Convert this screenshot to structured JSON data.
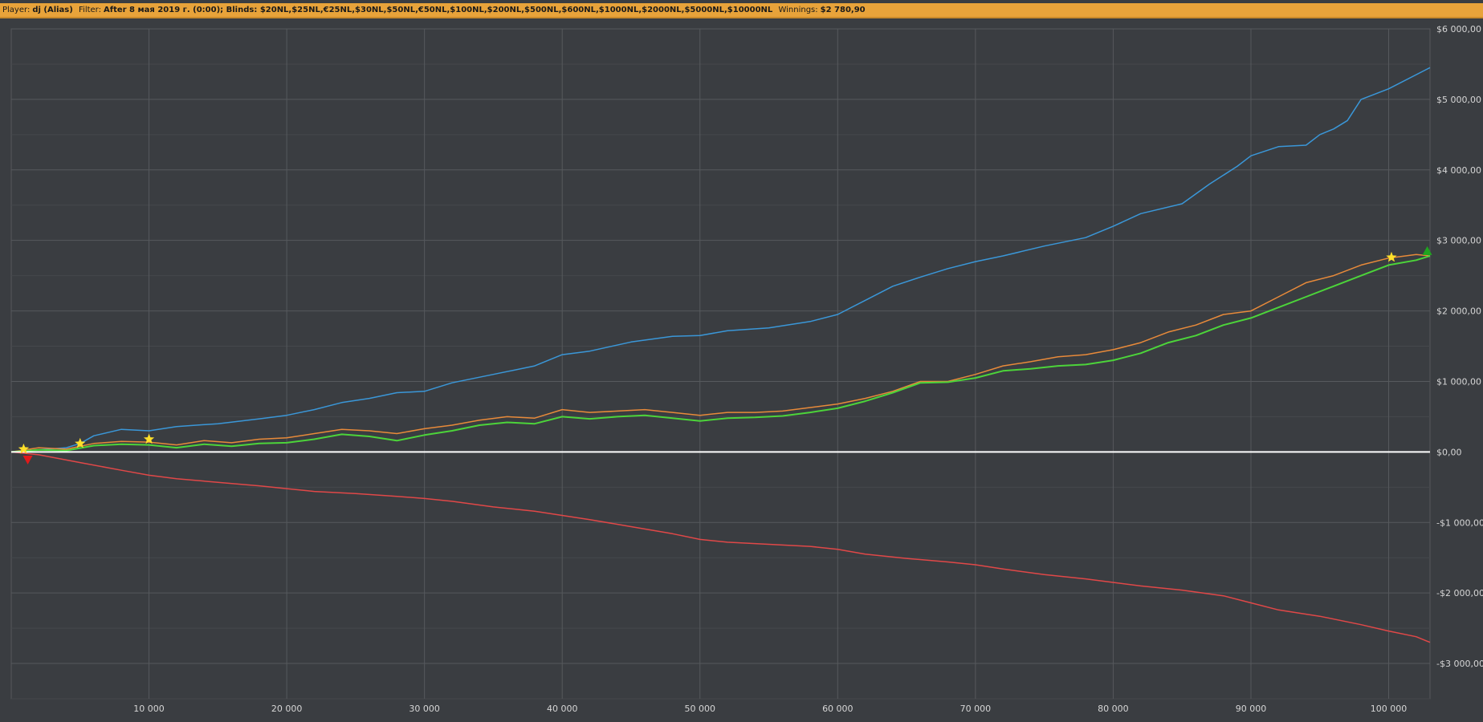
{
  "header": {
    "player_label": "Player:",
    "player_value": "dj (Alias)",
    "filter_label": "Filter:",
    "filter_value": "After 8 мая 2019 г. (0:00); Blinds: $20NL,$25NL,€25NL,$30NL,$50NL,€50NL,$100NL,$200NL,$500NL,$600NL,$1000NL,$2000NL,$5000NL,$10000NL",
    "winnings_label": "Winnings:",
    "winnings_value": "$2 780,90"
  },
  "chart_data": {
    "type": "line",
    "title": "",
    "xlabel": "",
    "ylabel": "",
    "xlim": [
      0,
      103000
    ],
    "ylim": [
      -3500,
      6000
    ],
    "x_ticks": [
      10000,
      20000,
      30000,
      40000,
      50000,
      60000,
      70000,
      80000,
      90000,
      100000
    ],
    "x_tick_labels": [
      "10 000",
      "20 000",
      "30 000",
      "40 000",
      "50 000",
      "60 000",
      "70 000",
      "80 000",
      "90 000",
      "100 000"
    ],
    "y_ticks": [
      6000,
      5000,
      4000,
      3000,
      2000,
      1000,
      0,
      -1000,
      -2000,
      -3000
    ],
    "y_tick_labels": [
      "$6 000,00",
      "$5 000,00",
      "$4 000,00",
      "$3 000,00",
      "$2 000,00",
      "$1 000,00",
      "$0,00",
      "-$1 000,00",
      "-$2 000,00",
      "-$3 000,00"
    ],
    "grid": true,
    "zero_line_color": "#ffffff",
    "series": [
      {
        "color": "#3a97d8",
        "x": [
          0,
          2000,
          4000,
          5000,
          6000,
          8000,
          10000,
          12000,
          15000,
          18000,
          20000,
          22000,
          24000,
          26000,
          28000,
          30000,
          32000,
          35000,
          38000,
          40000,
          42000,
          45000,
          48000,
          50000,
          52000,
          55000,
          58000,
          60000,
          62000,
          64000,
          66000,
          68000,
          70000,
          72000,
          75000,
          78000,
          80000,
          82000,
          85000,
          87000,
          89000,
          90000,
          92000,
          94000,
          95000,
          96000,
          97000,
          98000,
          100000,
          103000
        ],
        "y": [
          0,
          30,
          60,
          120,
          230,
          320,
          300,
          360,
          400,
          470,
          520,
          600,
          700,
          760,
          840,
          860,
          980,
          1100,
          1220,
          1380,
          1430,
          1560,
          1640,
          1650,
          1720,
          1760,
          1850,
          1950,
          2150,
          2350,
          2480,
          2600,
          2700,
          2780,
          2920,
          3040,
          3200,
          3380,
          3520,
          3800,
          4050,
          4200,
          4330,
          4350,
          4500,
          4580,
          4700,
          5000,
          5150,
          5450
        ]
      },
      {
        "color": "#e88a3a",
        "x": [
          0,
          2000,
          4000,
          6000,
          8000,
          10000,
          12000,
          14000,
          16000,
          18000,
          20000,
          22000,
          24000,
          26000,
          28000,
          30000,
          32000,
          34000,
          36000,
          38000,
          40000,
          42000,
          44000,
          46000,
          48000,
          50000,
          52000,
          54000,
          56000,
          58000,
          60000,
          62000,
          64000,
          66000,
          68000,
          70000,
          72000,
          74000,
          76000,
          78000,
          80000,
          82000,
          84000,
          86000,
          88000,
          90000,
          92000,
          94000,
          96000,
          98000,
          100000,
          102000,
          103000
        ],
        "y": [
          0,
          60,
          40,
          120,
          150,
          140,
          100,
          160,
          130,
          180,
          200,
          260,
          320,
          300,
          260,
          330,
          380,
          450,
          500,
          480,
          600,
          560,
          580,
          600,
          560,
          520,
          560,
          560,
          580,
          630,
          680,
          760,
          860,
          1000,
          1000,
          1100,
          1220,
          1280,
          1350,
          1380,
          1450,
          1550,
          1700,
          1800,
          1950,
          2000,
          2200,
          2400,
          2500,
          2650,
          2750,
          2800,
          2780
        ]
      },
      {
        "color": "#4cd43a",
        "x": [
          0,
          2000,
          4000,
          6000,
          8000,
          10000,
          12000,
          14000,
          16000,
          18000,
          20000,
          22000,
          24000,
          26000,
          28000,
          30000,
          32000,
          34000,
          36000,
          38000,
          40000,
          42000,
          44000,
          46000,
          48000,
          50000,
          52000,
          54000,
          56000,
          58000,
          60000,
          62000,
          64000,
          66000,
          68000,
          70000,
          72000,
          74000,
          76000,
          78000,
          80000,
          82000,
          84000,
          86000,
          88000,
          90000,
          92000,
          94000,
          96000,
          98000,
          100000,
          102000,
          103000
        ],
        "y": [
          0,
          30,
          20,
          90,
          110,
          100,
          60,
          110,
          80,
          120,
          130,
          180,
          250,
          220,
          160,
          240,
          300,
          380,
          420,
          400,
          500,
          470,
          500,
          520,
          480,
          440,
          480,
          490,
          510,
          560,
          620,
          720,
          840,
          980,
          990,
          1050,
          1150,
          1180,
          1220,
          1240,
          1300,
          1400,
          1550,
          1650,
          1800,
          1900,
          2050,
          2200,
          2350,
          2500,
          2650,
          2720,
          2780
        ]
      },
      {
        "color": "#e04848",
        "x": [
          0,
          2000,
          5000,
          8000,
          10000,
          12000,
          15000,
          18000,
          20000,
          22000,
          25000,
          28000,
          30000,
          32000,
          35000,
          38000,
          40000,
          42000,
          45000,
          48000,
          50000,
          52000,
          55000,
          58000,
          60000,
          62000,
          65000,
          68000,
          70000,
          72000,
          75000,
          78000,
          80000,
          82000,
          85000,
          88000,
          90000,
          92000,
          95000,
          98000,
          100000,
          102000,
          103000
        ],
        "y": [
          0,
          -40,
          -150,
          -260,
          -330,
          -380,
          -430,
          -480,
          -520,
          -560,
          -590,
          -630,
          -660,
          -700,
          -780,
          -840,
          -900,
          -960,
          -1060,
          -1160,
          -1240,
          -1280,
          -1310,
          -1340,
          -1380,
          -1450,
          -1510,
          -1560,
          -1600,
          -1660,
          -1740,
          -1800,
          -1850,
          -1900,
          -1960,
          -2040,
          -2140,
          -2240,
          -2330,
          -2450,
          -2540,
          -2620,
          -2700
        ]
      }
    ],
    "markers": [
      {
        "type": "star",
        "color": "#ffe02a",
        "x": 900,
        "y": 40
      },
      {
        "type": "star",
        "color": "#ffe02a",
        "x": 5000,
        "y": 120
      },
      {
        "type": "star",
        "color": "#ffe02a",
        "x": 10000,
        "y": 180
      },
      {
        "type": "star",
        "color": "#ffe02a",
        "x": 100200,
        "y": 2760
      },
      {
        "type": "triangle-down",
        "color": "#e01a1a",
        "x": 1200,
        "y": -110
      },
      {
        "type": "triangle-up",
        "color": "#1fa51f",
        "x": 102800,
        "y": 2850
      }
    ]
  }
}
